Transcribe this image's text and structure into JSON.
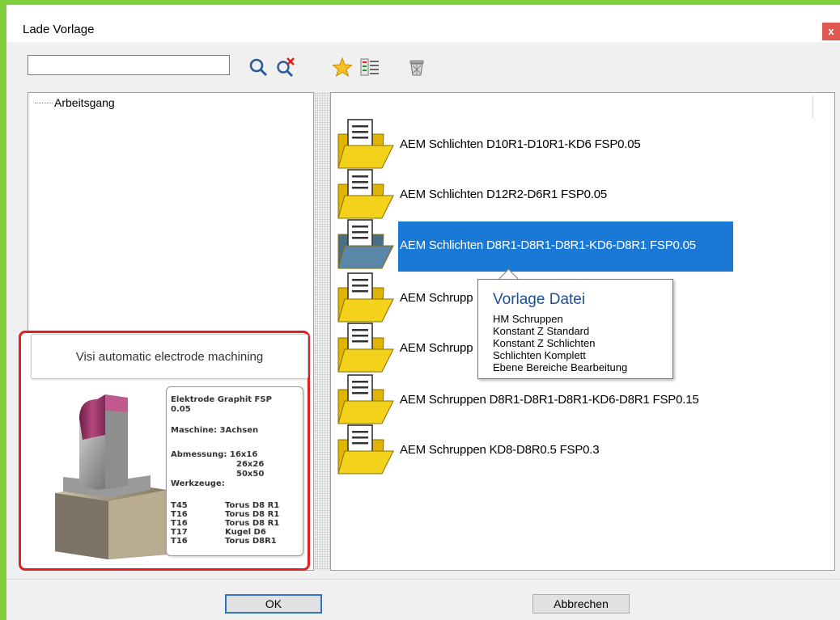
{
  "window": {
    "title": "Lade Vorlage",
    "close_label": "x",
    "accent_color": "#7fcf3f"
  },
  "toolbar": {
    "search_value": "",
    "icons": [
      "search-icon",
      "clear-search-icon",
      "favorite-star-icon",
      "template-list-icon",
      "delete-basket-icon"
    ]
  },
  "tree": {
    "root_label": "Arbeitsgang"
  },
  "templates": [
    {
      "label": "AEM Schlichten D10R1-D10R1-KD6 FSP0.05",
      "selected": false
    },
    {
      "label": "AEM Schlichten D12R2-D6R1 FSP0.05",
      "selected": false
    },
    {
      "label": "AEM Schlichten D8R1-D8R1-D8R1-KD6-D8R1 FSP0.05",
      "selected": true
    },
    {
      "label": "AEM Schrupp",
      "selected": false
    },
    {
      "label": "AEM Schrupp",
      "selected": false
    },
    {
      "label": "AEM Schruppen D8R1-D8R1-D8R1-KD6-D8R1 FSP0.15",
      "selected": false
    },
    {
      "label": "AEM Schruppen KD8-D8R0.5 FSP0.3",
      "selected": false
    }
  ],
  "tooltip": {
    "title": "Vorlage Datei",
    "lines": [
      "HM Schruppen",
      "Konstant Z Standard",
      "Konstant Z Schlichten",
      "Schlichten Komplett",
      "Ebene Bereiche Bearbeitung"
    ]
  },
  "preview": {
    "caption": "Visi automatic electrode machining",
    "card": {
      "material": "Elektrode Graphit FSP 0.05",
      "material_line1": "Elektrode Graphit FSP",
      "material_line2": "0.05",
      "machine": "Maschine: 3Achsen",
      "dimension_label": "Abmessung:",
      "dimensions": [
        "16x16",
        "26x26",
        "50x50"
      ],
      "tools_label": "Werkzeuge:",
      "tools": [
        {
          "id": "T45",
          "name": "Torus D8 R1"
        },
        {
          "id": "T16",
          "name": "Torus D8 R1"
        },
        {
          "id": "T16",
          "name": "Torus D8 R1"
        },
        {
          "id": "T17",
          "name": "Kugel D6"
        },
        {
          "id": "T16",
          "name": "Torus D8R1"
        }
      ]
    }
  },
  "buttons": {
    "ok": "OK",
    "cancel": "Abbrechen"
  },
  "colors": {
    "selection": "#1a79d6",
    "tooltip_title": "#1f4f96",
    "highlight_border": "#e02020",
    "close_button": "#e0584f"
  }
}
